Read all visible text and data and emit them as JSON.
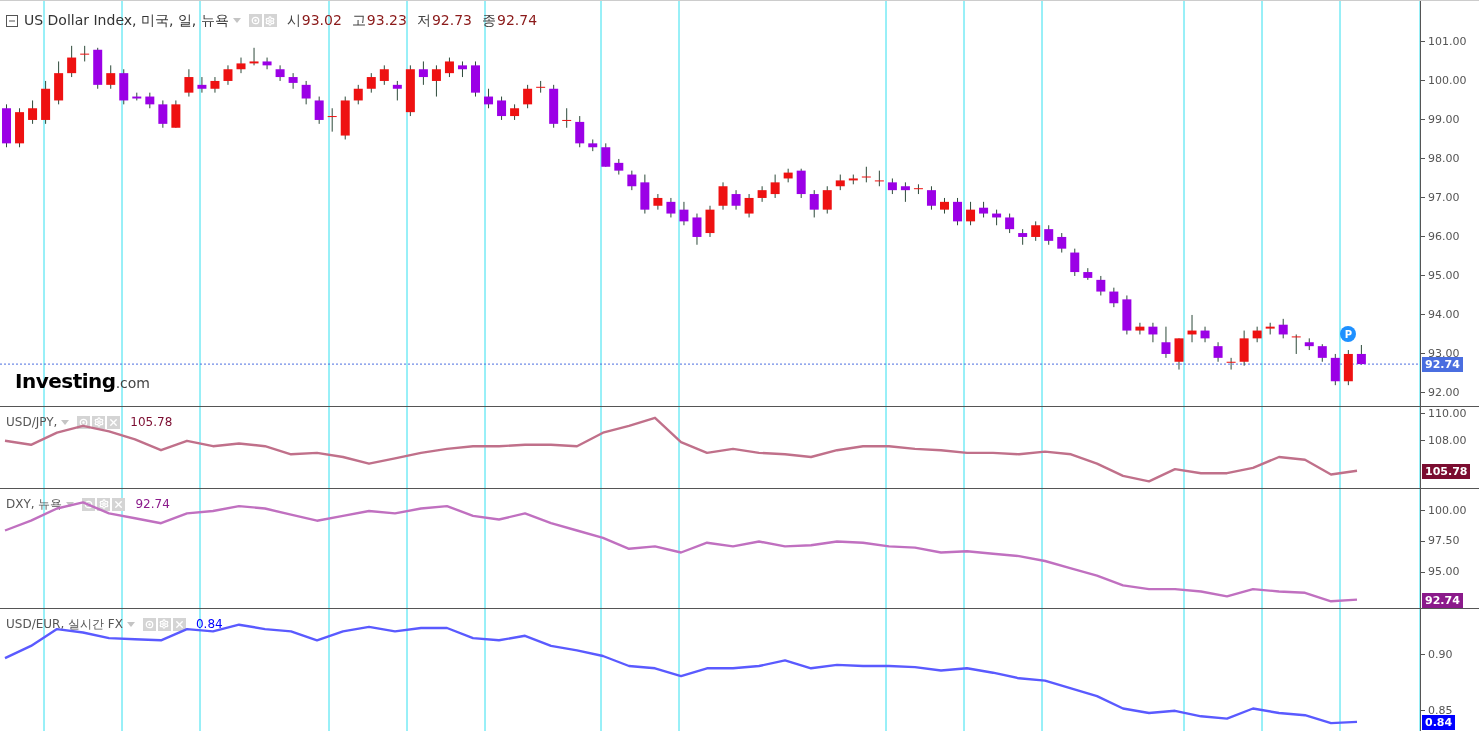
{
  "header": {
    "title": "US Dollar Index, 미국, 일, 뉴욕",
    "ohlc": [
      {
        "label": "시",
        "value": "93.02"
      },
      {
        "label": "고",
        "value": "93.23"
      },
      {
        "label": "저",
        "value": "92.73"
      },
      {
        "label": "종",
        "value": "92.74"
      }
    ]
  },
  "main_pane": {
    "chart_data": {
      "type": "candlestick",
      "grid": true,
      "ylim": [
        91.64,
        102.05
      ],
      "yticks": [
        {
          "value": 92,
          "label": "92.00"
        },
        {
          "value": 93,
          "label": "93.00"
        },
        {
          "value": 94,
          "label": "94.00"
        },
        {
          "value": 95,
          "label": "95.00"
        },
        {
          "value": 96,
          "label": "96.00"
        },
        {
          "value": 97,
          "label": "97.00"
        },
        {
          "value": 98,
          "label": "98.00"
        },
        {
          "value": 99,
          "label": "99.00"
        },
        {
          "value": 100,
          "label": "100.00"
        },
        {
          "value": 101,
          "label": "101.00"
        }
      ],
      "ref_lines": [
        {
          "axis": "y",
          "value": 92.74,
          "label": "92.74",
          "color": "#4a6ee0"
        }
      ],
      "categories": [
        null,
        null,
        null,
        null,
        null,
        null,
        null,
        null,
        null,
        null,
        null,
        null,
        null,
        null,
        null,
        null,
        null,
        null,
        null,
        null,
        null,
        null,
        null,
        null,
        null,
        null,
        null,
        null,
        null,
        null,
        null,
        null,
        null,
        null,
        null,
        null,
        null,
        null,
        null,
        null,
        null,
        null,
        null,
        null,
        null,
        null,
        null,
        null,
        null,
        null,
        null,
        null,
        null,
        null,
        null,
        null,
        null,
        null,
        null,
        null,
        null,
        null,
        null,
        null,
        null,
        null,
        null,
        null,
        null,
        null,
        null,
        null,
        null,
        null,
        null,
        null,
        null,
        null,
        null,
        null,
        null,
        null,
        null,
        null,
        null,
        null,
        null,
        null,
        null,
        null,
        null,
        null,
        null,
        null,
        null,
        null,
        null,
        null,
        null,
        null,
        null,
        null,
        null,
        null,
        null,
        null,
        null,
        null,
        null
      ],
      "ohlc": [
        [
          99.3,
          99.4,
          98.3,
          98.4
        ],
        [
          98.4,
          99.3,
          98.3,
          99.2
        ],
        [
          99.0,
          99.5,
          98.9,
          99.3
        ],
        [
          99.0,
          100.0,
          98.9,
          99.8
        ],
        [
          99.5,
          100.5,
          99.4,
          100.2
        ],
        [
          100.2,
          100.9,
          100.1,
          100.6
        ],
        [
          100.7,
          100.9,
          100.5,
          100.7
        ],
        [
          100.8,
          100.85,
          99.8,
          99.9
        ],
        [
          99.9,
          100.4,
          99.8,
          100.2
        ],
        [
          100.2,
          100.3,
          99.4,
          99.5
        ],
        [
          99.6,
          99.7,
          99.5,
          99.55
        ],
        [
          99.6,
          99.7,
          99.3,
          99.4
        ],
        [
          99.4,
          99.5,
          98.8,
          98.9
        ],
        [
          98.8,
          99.5,
          98.8,
          99.4
        ],
        [
          99.7,
          100.3,
          99.6,
          100.1
        ],
        [
          99.9,
          100.1,
          99.7,
          99.8
        ],
        [
          99.8,
          100.1,
          99.7,
          100.0
        ],
        [
          100.0,
          100.4,
          99.9,
          100.3
        ],
        [
          100.3,
          100.6,
          100.2,
          100.45
        ],
        [
          100.45,
          100.85,
          100.4,
          100.5
        ],
        [
          100.5,
          100.6,
          100.3,
          100.4
        ],
        [
          100.3,
          100.4,
          100.0,
          100.1
        ],
        [
          100.1,
          100.2,
          99.8,
          99.95
        ],
        [
          99.9,
          100.0,
          99.4,
          99.55
        ],
        [
          99.5,
          99.6,
          98.9,
          99.0
        ],
        [
          99.1,
          99.3,
          98.7,
          99.1
        ],
        [
          98.6,
          99.6,
          98.5,
          99.5
        ],
        [
          99.5,
          99.9,
          99.4,
          99.8
        ],
        [
          99.8,
          100.2,
          99.7,
          100.1
        ],
        [
          100.0,
          100.4,
          99.9,
          100.3
        ],
        [
          99.9,
          100.0,
          99.5,
          99.8
        ],
        [
          99.2,
          100.4,
          99.1,
          100.3
        ],
        [
          100.3,
          100.5,
          99.9,
          100.1
        ],
        [
          100.0,
          100.4,
          99.6,
          100.3
        ],
        [
          100.2,
          100.6,
          100.1,
          100.5
        ],
        [
          100.4,
          100.5,
          100.1,
          100.3
        ],
        [
          100.4,
          100.5,
          99.6,
          99.7
        ],
        [
          99.6,
          99.8,
          99.3,
          99.4
        ],
        [
          99.5,
          99.6,
          99.0,
          99.1
        ],
        [
          99.1,
          99.4,
          99.0,
          99.3
        ],
        [
          99.4,
          99.9,
          99.3,
          99.8
        ],
        [
          99.85,
          100.0,
          99.7,
          99.85
        ],
        [
          99.8,
          99.9,
          98.8,
          98.9
        ],
        [
          99.0,
          99.3,
          98.8,
          99.0
        ],
        [
          98.95,
          99.1,
          98.3,
          98.4
        ],
        [
          98.4,
          98.5,
          98.2,
          98.3
        ],
        [
          98.3,
          98.4,
          97.8,
          97.8
        ],
        [
          97.9,
          98.0,
          97.6,
          97.7
        ],
        [
          97.6,
          97.7,
          97.2,
          97.3
        ],
        [
          97.4,
          97.6,
          96.6,
          96.7
        ],
        [
          96.8,
          97.1,
          96.7,
          97.0
        ],
        [
          96.9,
          97.0,
          96.5,
          96.6
        ],
        [
          96.7,
          96.9,
          96.3,
          96.4
        ],
        [
          96.5,
          96.6,
          95.8,
          96.0
        ],
        [
          96.1,
          96.8,
          96.0,
          96.7
        ],
        [
          96.8,
          97.4,
          96.7,
          97.3
        ],
        [
          97.1,
          97.2,
          96.7,
          96.8
        ],
        [
          96.6,
          97.1,
          96.5,
          97.0
        ],
        [
          97.0,
          97.3,
          96.9,
          97.2
        ],
        [
          97.1,
          97.6,
          97.0,
          97.4
        ],
        [
          97.5,
          97.75,
          97.4,
          97.65
        ],
        [
          97.7,
          97.75,
          97.0,
          97.1
        ],
        [
          97.1,
          97.2,
          96.5,
          96.7
        ],
        [
          96.7,
          97.3,
          96.6,
          97.2
        ],
        [
          97.3,
          97.6,
          97.2,
          97.45
        ],
        [
          97.45,
          97.6,
          97.35,
          97.5
        ],
        [
          97.55,
          97.8,
          97.4,
          97.55
        ],
        [
          97.45,
          97.7,
          97.3,
          97.45
        ],
        [
          97.4,
          97.5,
          97.1,
          97.2
        ],
        [
          97.3,
          97.4,
          96.9,
          97.2
        ],
        [
          97.25,
          97.35,
          97.1,
          97.25
        ],
        [
          97.2,
          97.3,
          96.7,
          96.8
        ],
        [
          96.7,
          97.0,
          96.6,
          96.9
        ],
        [
          96.9,
          97.0,
          96.3,
          96.4
        ],
        [
          96.4,
          96.9,
          96.3,
          96.7
        ],
        [
          96.75,
          96.9,
          96.5,
          96.6
        ],
        [
          96.6,
          96.7,
          96.3,
          96.5
        ],
        [
          96.5,
          96.6,
          96.1,
          96.2
        ],
        [
          96.1,
          96.2,
          95.8,
          96.0
        ],
        [
          96.0,
          96.4,
          95.9,
          96.3
        ],
        [
          96.2,
          96.3,
          95.8,
          95.9
        ],
        [
          96.0,
          96.1,
          95.6,
          95.7
        ],
        [
          95.6,
          95.7,
          95.0,
          95.1
        ],
        [
          95.1,
          95.2,
          94.9,
          94.95
        ],
        [
          94.9,
          95.0,
          94.5,
          94.6
        ],
        [
          94.6,
          94.7,
          94.2,
          94.3
        ],
        [
          94.4,
          94.5,
          93.5,
          93.6
        ],
        [
          93.6,
          93.8,
          93.5,
          93.7
        ],
        [
          93.7,
          93.8,
          93.3,
          93.5
        ],
        [
          93.3,
          93.7,
          92.9,
          93.0
        ],
        [
          92.8,
          93.4,
          92.6,
          93.4
        ],
        [
          93.5,
          94.0,
          93.3,
          93.6
        ],
        [
          93.6,
          93.7,
          93.3,
          93.4
        ],
        [
          93.2,
          93.3,
          92.8,
          92.9
        ],
        [
          92.8,
          92.9,
          92.6,
          92.8
        ],
        [
          92.8,
          93.6,
          92.7,
          93.4
        ],
        [
          93.4,
          93.7,
          93.3,
          93.6
        ],
        [
          93.65,
          93.8,
          93.5,
          93.7
        ],
        [
          93.75,
          93.9,
          93.4,
          93.5
        ],
        [
          93.45,
          93.5,
          93.0,
          93.45
        ],
        [
          93.3,
          93.4,
          93.1,
          93.2
        ],
        [
          93.2,
          93.25,
          92.8,
          92.9
        ],
        [
          92.9,
          93.0,
          92.2,
          92.3
        ],
        [
          92.3,
          93.1,
          92.2,
          93.0
        ],
        [
          93.0,
          93.23,
          92.73,
          92.74
        ],
        null,
        null,
        null,
        null
      ]
    },
    "marker": {
      "label": "P"
    },
    "logo": {
      "text": "Investing",
      "suffix": ".com"
    }
  },
  "panes": [
    {
      "title": "USD/JPY,",
      "value": "105.78",
      "badge": {
        "label": "105.78",
        "color": "#7b0c30"
      },
      "chart_data": {
        "type": "line",
        "grid": true,
        "ylim": [
          104.43,
          110.5
        ],
        "yticks": [
          {
            "value": 108,
            "label": "108.00"
          },
          {
            "value": 110,
            "label": "110.00"
          }
        ],
        "series": [
          {
            "color": "#c0708a",
            "values": [
              108.0,
              107.7,
              108.6,
              109.1,
              108.7,
              108.1,
              107.3,
              108.0,
              107.6,
              107.8,
              107.6,
              107.0,
              107.1,
              106.8,
              106.3,
              106.7,
              107.1,
              107.4,
              107.6,
              107.6,
              107.7,
              107.7,
              107.6,
              108.6,
              109.1,
              109.7,
              107.9,
              107.1,
              107.4,
              107.1,
              107.0,
              106.8,
              107.3,
              107.6,
              107.6,
              107.4,
              107.3,
              107.1,
              107.1,
              107.0,
              107.2,
              107.0,
              106.3,
              105.4,
              105.0,
              105.9,
              105.6,
              105.6,
              106.0,
              106.8,
              106.6,
              105.5,
              105.78
            ]
          }
        ]
      }
    },
    {
      "title": "DXY, 뉴욕",
      "value": "92.74",
      "badge": {
        "label": "92.74",
        "color": "#8b1a8b"
      },
      "chart_data": {
        "type": "line",
        "grid": true,
        "ylim": [
          91.97,
          101.8
        ],
        "yticks": [
          {
            "value": 95,
            "label": "95.00"
          },
          {
            "value": 97.5,
            "label": "97.50"
          },
          {
            "value": 100,
            "label": "100.00"
          }
        ],
        "series": [
          {
            "color": "#c070c0",
            "values": [
              98.4,
              99.2,
              100.2,
              100.7,
              99.8,
              99.4,
              99.0,
              99.8,
              100.0,
              100.4,
              100.2,
              99.7,
              99.2,
              99.6,
              100.0,
              99.8,
              100.2,
              100.4,
              99.6,
              99.3,
              99.8,
              99.0,
              98.4,
              97.8,
              96.9,
              97.1,
              96.6,
              97.4,
              97.1,
              97.5,
              97.1,
              97.2,
              97.5,
              97.4,
              97.1,
              97.0,
              96.6,
              96.7,
              96.5,
              96.3,
              95.9,
              95.3,
              94.7,
              93.9,
              93.6,
              93.6,
              93.4,
              93.0,
              93.6,
              93.4,
              93.3,
              92.6,
              92.74
            ]
          }
        ]
      }
    },
    {
      "title": "USD/EUR, 실시간 FX",
      "value": "0.84",
      "badge": {
        "label": "0.84",
        "color": "#0000ff"
      },
      "chart_data": {
        "type": "line",
        "grid": true,
        "ylim": [
          0.831,
          0.941
        ],
        "yticks": [
          {
            "value": 0.85,
            "label": "0.85"
          },
          {
            "value": 0.9,
            "label": "0.90"
          }
        ],
        "series": [
          {
            "color": "#5a5aff",
            "values": [
              0.897,
              0.908,
              0.923,
              0.92,
              0.915,
              0.914,
              0.913,
              0.923,
              0.921,
              0.927,
              0.923,
              0.921,
              0.913,
              0.921,
              0.925,
              0.921,
              0.924,
              0.924,
              0.915,
              0.913,
              0.917,
              0.908,
              0.904,
              0.899,
              0.89,
              0.888,
              0.881,
              0.888,
              0.888,
              0.89,
              0.895,
              0.888,
              0.891,
              0.89,
              0.89,
              0.889,
              0.886,
              0.888,
              0.884,
              0.879,
              0.877,
              0.87,
              0.863,
              0.852,
              0.848,
              0.85,
              0.845,
              0.843,
              0.852,
              0.848,
              0.846,
              0.839,
              0.84
            ]
          }
        ]
      }
    }
  ]
}
